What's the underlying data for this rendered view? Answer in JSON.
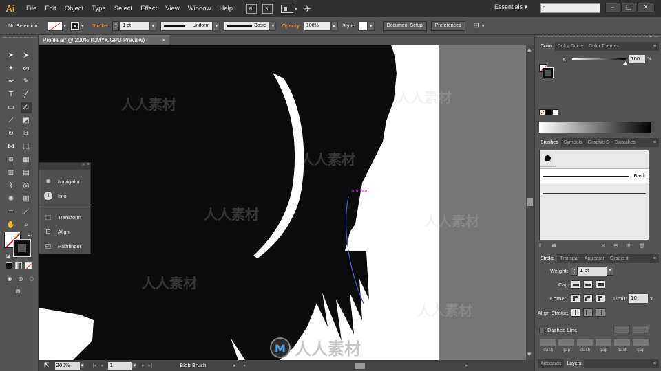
{
  "app": {
    "logo": "Ai",
    "workspace": "Essentials"
  },
  "menu": [
    "File",
    "Edit",
    "Object",
    "Type",
    "Select",
    "Effect",
    "View",
    "Window",
    "Help"
  ],
  "bridge_badges": [
    "Br",
    "St"
  ],
  "control": {
    "selection": "No Selection",
    "stroke_label": "Stroke:",
    "stroke_value": "1 pt",
    "profile": "Uniform",
    "brush": "Basic",
    "opacity_label": "Opacity:",
    "opacity_value": "100%",
    "style_label": "Style:",
    "doc_setup": "Document Setup",
    "preferences": "Preferences"
  },
  "document": {
    "tab": "Profile.ai* @ 200% (CMYK/GPU Preview)",
    "close": "×"
  },
  "canvas": {
    "anchor_label": "anchor"
  },
  "floating_panel": [
    "Navigator",
    "Info",
    "Transform",
    "Align",
    "Pathfinder"
  ],
  "color_panel": {
    "tabs": [
      "Color",
      "Color Guide",
      "Color Themes"
    ],
    "channel": "K",
    "value": "100",
    "unit": "%"
  },
  "brushes_panel": {
    "tabs": [
      "Brushes",
      "Symbols",
      "Graphic S",
      "Swatches"
    ],
    "selected_brush": "Basic"
  },
  "stroke_panel": {
    "tabs": [
      "Stroke",
      "Transpar",
      "Appearar",
      "Gradient"
    ],
    "weight_label": "Weight:",
    "weight_value": "1 pt",
    "cap_label": "Cap:",
    "corner_label": "Corner:",
    "limit_label": "Limit:",
    "limit_value": "10",
    "limit_unit": "x",
    "align_label": "Align Stroke:",
    "dashed_label": "Dashed Line",
    "dash_labels": [
      "dash",
      "gap",
      "dash",
      "gap",
      "dash",
      "gap"
    ]
  },
  "bottom_tabs": [
    "Artboards",
    "Layers"
  ],
  "status": {
    "zoom": "200%",
    "artboard": "1",
    "tool": "Blob Brush"
  },
  "watermark": {
    "brand": "人人素材",
    "logo_mark": "M"
  },
  "colors": {
    "menubar": "#323232",
    "panel": "#535353",
    "accent": "#e8a13a",
    "artboard_black": "#0c0c0c"
  }
}
